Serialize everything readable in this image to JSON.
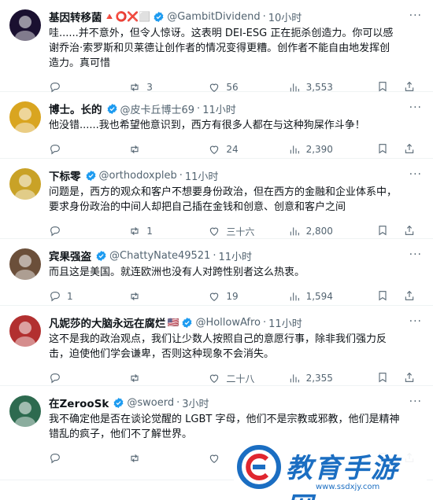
{
  "tweets": [
    {
      "name": "基因转移菌",
      "emoji": "🔺⭕❌⬜",
      "handle": "@GambitDividend",
      "time": "10小时",
      "text": "哇......并不意外，但令人惊讶。这表明 DEI-ESG 正在扼杀创造力。你可以感谢乔治·索罗斯和贝莱德让创作者的情况变得更糟。创作者不能自由地发挥创造力。真可惜",
      "reply": "",
      "retweet": "3",
      "like": "56",
      "views": "3,553",
      "avatar_color": "#1a1030"
    },
    {
      "name": "博士。长的",
      "emoji": "",
      "handle": "@皮卡丘博士69",
      "time": "11小时",
      "text": "他没错......我也希望他意识到，西方有很多人都在与这种狗屎作斗争！",
      "reply": "",
      "retweet": "",
      "like": "24",
      "views": "2,390",
      "avatar_color": "#d9a520"
    },
    {
      "name": "下标零",
      "emoji": "",
      "handle": "@orthodoxpleb",
      "time": "11小时",
      "text": "问题是，西方的观众和客户不想要身份政治，但在西方的金融和企业体系中，要求身份政治的中间人却把自己插在金钱和创意、创意和客户之间",
      "reply": "",
      "retweet": "1",
      "like": "三十六",
      "views": "2,800",
      "avatar_color": "#c9a227"
    },
    {
      "name": "宾果强盗",
      "emoji": "",
      "handle": "@ChattyNate49521",
      "time": "11小时",
      "text": "而且这是美国。就连欧洲也没有人对跨性别者这么热衷。",
      "reply": "1",
      "retweet": "",
      "like": "19",
      "views": "1,594",
      "avatar_color": "#6b4f3a"
    },
    {
      "name": "凡妮莎的大脑永远在腐烂",
      "emoji": "🇺🇸",
      "handle": "@HollowAfro",
      "time": "11小时",
      "text": "这不是我的政治观点，我们让少数人按照自己的意愿行事，除非我们强力反击，迫使他们学会谦卑，否则这种现象不会消失。",
      "reply": "",
      "retweet": "",
      "like": "二十八",
      "views": "2,355",
      "avatar_color": "#b23030"
    },
    {
      "name": "在ZerooSk",
      "emoji": "",
      "handle": "@swoerd",
      "time": "3小时",
      "text": "我不确定他是否在谈论觉醒的 LGBT 字母，他们不是宗教或邪教，他们是精神错乱的疯子，他们不了解世界。",
      "reply": "",
      "retweet": "",
      "like": "",
      "views": "",
      "avatar_color": "#2d6a4f"
    }
  ],
  "watermark": {
    "title": "教育手游网",
    "url": "www.ssdxjy.com",
    "color": "#1b6ec2"
  },
  "icons": [
    "reply-icon",
    "retweet-icon",
    "like-icon",
    "views-icon",
    "bookmark-icon",
    "share-icon",
    "verified-icon",
    "more-icon"
  ]
}
